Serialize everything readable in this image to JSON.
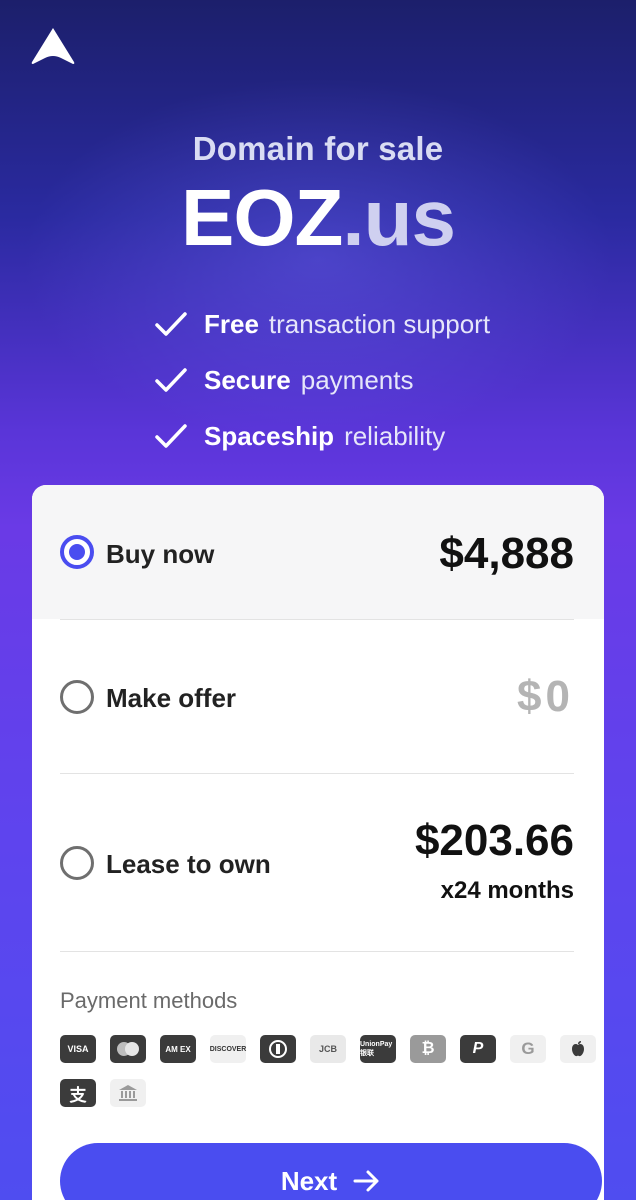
{
  "header": {
    "logo_icon": "spaceship-logo-icon",
    "subtitle": "Domain for sale",
    "domain_sld": "EOZ",
    "domain_tld": ".us"
  },
  "features": [
    {
      "bold": "Free",
      "text": "transaction support"
    },
    {
      "bold": "Secure",
      "text": "payments"
    },
    {
      "bold": "Spaceship",
      "text": "reliability"
    }
  ],
  "options": {
    "buy": {
      "label": "Buy now",
      "price": "$4,888",
      "selected": true
    },
    "offer": {
      "label": "Make offer",
      "price": "$0"
    },
    "lease": {
      "label": "Lease to own",
      "price": "$203.66",
      "sub": "x24 months"
    }
  },
  "payment": {
    "title": "Payment methods",
    "methods": [
      {
        "icon": "visa-icon",
        "text": "VISA"
      },
      {
        "icon": "mastercard-icon",
        "text": ""
      },
      {
        "icon": "amex-icon",
        "text": "AM EX"
      },
      {
        "icon": "discover-icon",
        "text": "DISCOVER"
      },
      {
        "icon": "diners-club-icon",
        "text": ""
      },
      {
        "icon": "jcb-icon",
        "text": "JCB"
      },
      {
        "icon": "unionpay-icon",
        "text": "UnionPay 银联"
      },
      {
        "icon": "bitcoin-icon",
        "text": "₿"
      },
      {
        "icon": "paypal-icon",
        "text": "P"
      },
      {
        "icon": "google-pay-icon",
        "text": "G"
      },
      {
        "icon": "apple-pay-icon",
        "text": ""
      },
      {
        "icon": "alipay-icon",
        "text": "支"
      },
      {
        "icon": "bank-transfer-icon",
        "text": ""
      }
    ]
  },
  "cta": {
    "next_label": "Next"
  },
  "colors": {
    "accent": "#4a4df0",
    "card_bg": "#ffffff",
    "selected_bg": "#f6f6f7"
  }
}
